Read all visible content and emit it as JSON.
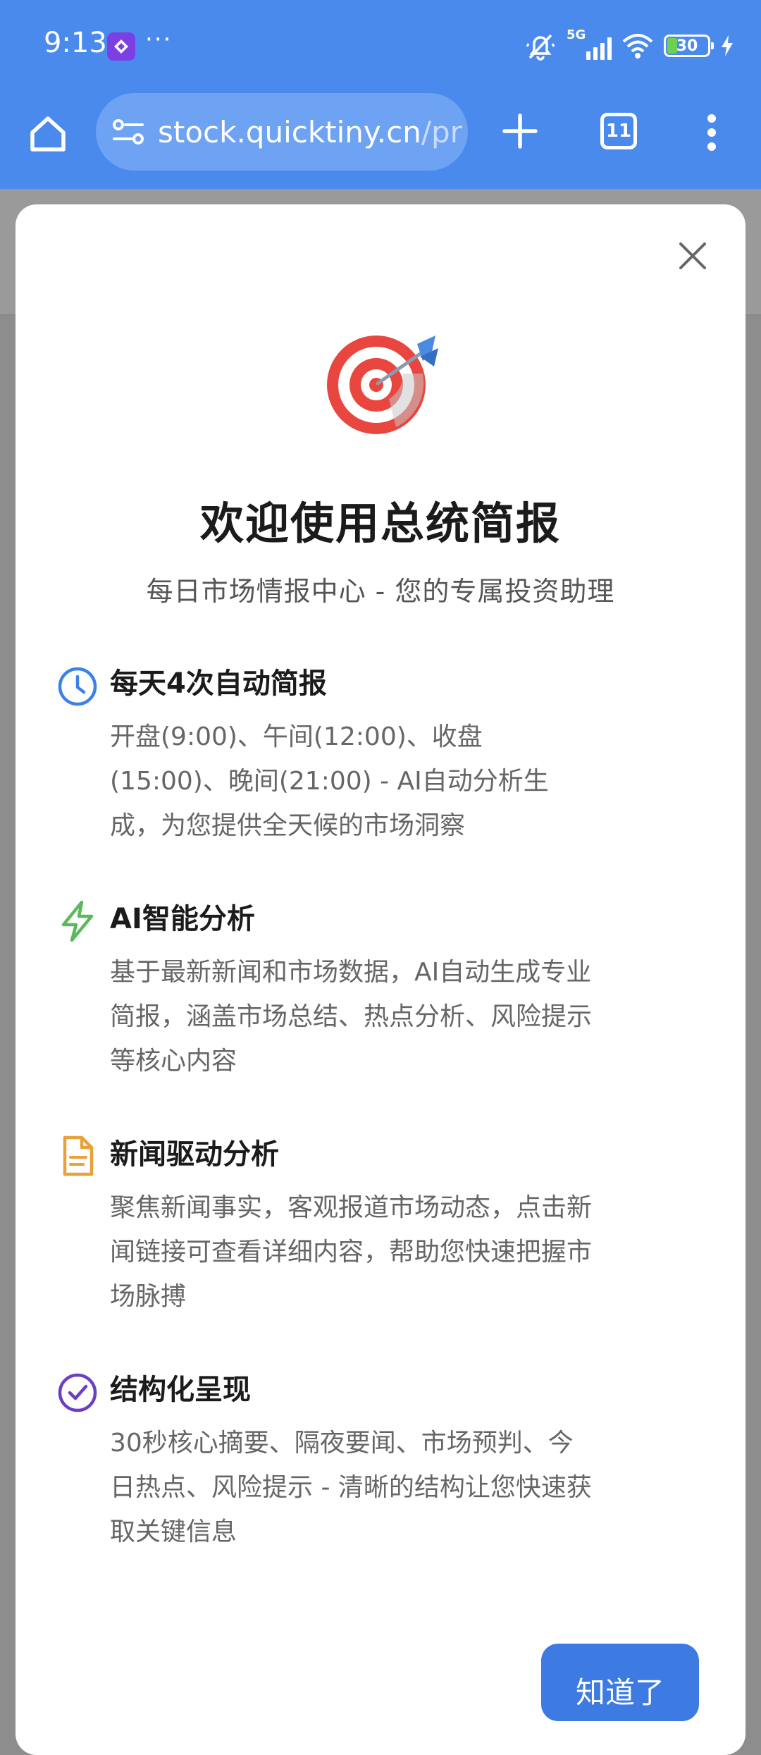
{
  "status_bar": {
    "time": "9:13",
    "more": "···",
    "network": "5G",
    "battery": "30"
  },
  "browser": {
    "url_main": "stock.quicktiny.cn",
    "url_rest": "/pr",
    "tab_count": "11"
  },
  "modal": {
    "title": "欢迎使用总统简报",
    "subtitle": "每日市场情报中心 - 您的专属投资助理",
    "features": [
      {
        "icon": "clock-icon",
        "title": "每天4次自动简报",
        "desc": "开盘(9:00)、午间(12:00)、收盘(15:00)、晚间(21:00) - AI自动分析生成，为您提供全天候的市场洞察"
      },
      {
        "icon": "lightning-icon",
        "title": "AI智能分析",
        "desc": "基于最新新闻和市场数据，AI自动生成专业简报，涵盖市场总结、热点分析、风险提示等核心内容"
      },
      {
        "icon": "document-icon",
        "title": "新闻驱动分析",
        "desc": "聚焦新闻事实，客观报道市场动态，点击新闻链接可查看详细内容，帮助您快速把握市场脉搏"
      },
      {
        "icon": "check-circle-icon",
        "title": "结构化呈现",
        "desc": "30秒核心摘要、隔夜要闻、市场预判、今日热点、风险提示 - 清晰的结构让您快速获取关键信息"
      }
    ],
    "confirm_label": "知道了"
  },
  "colors": {
    "brand_blue": "#4a8aed",
    "button_blue": "#3d7be2",
    "clock_blue": "#3b82e6",
    "lightning_green": "#5cb85c",
    "document_amber": "#e9a23b",
    "check_purple": "#6b3fc4"
  }
}
